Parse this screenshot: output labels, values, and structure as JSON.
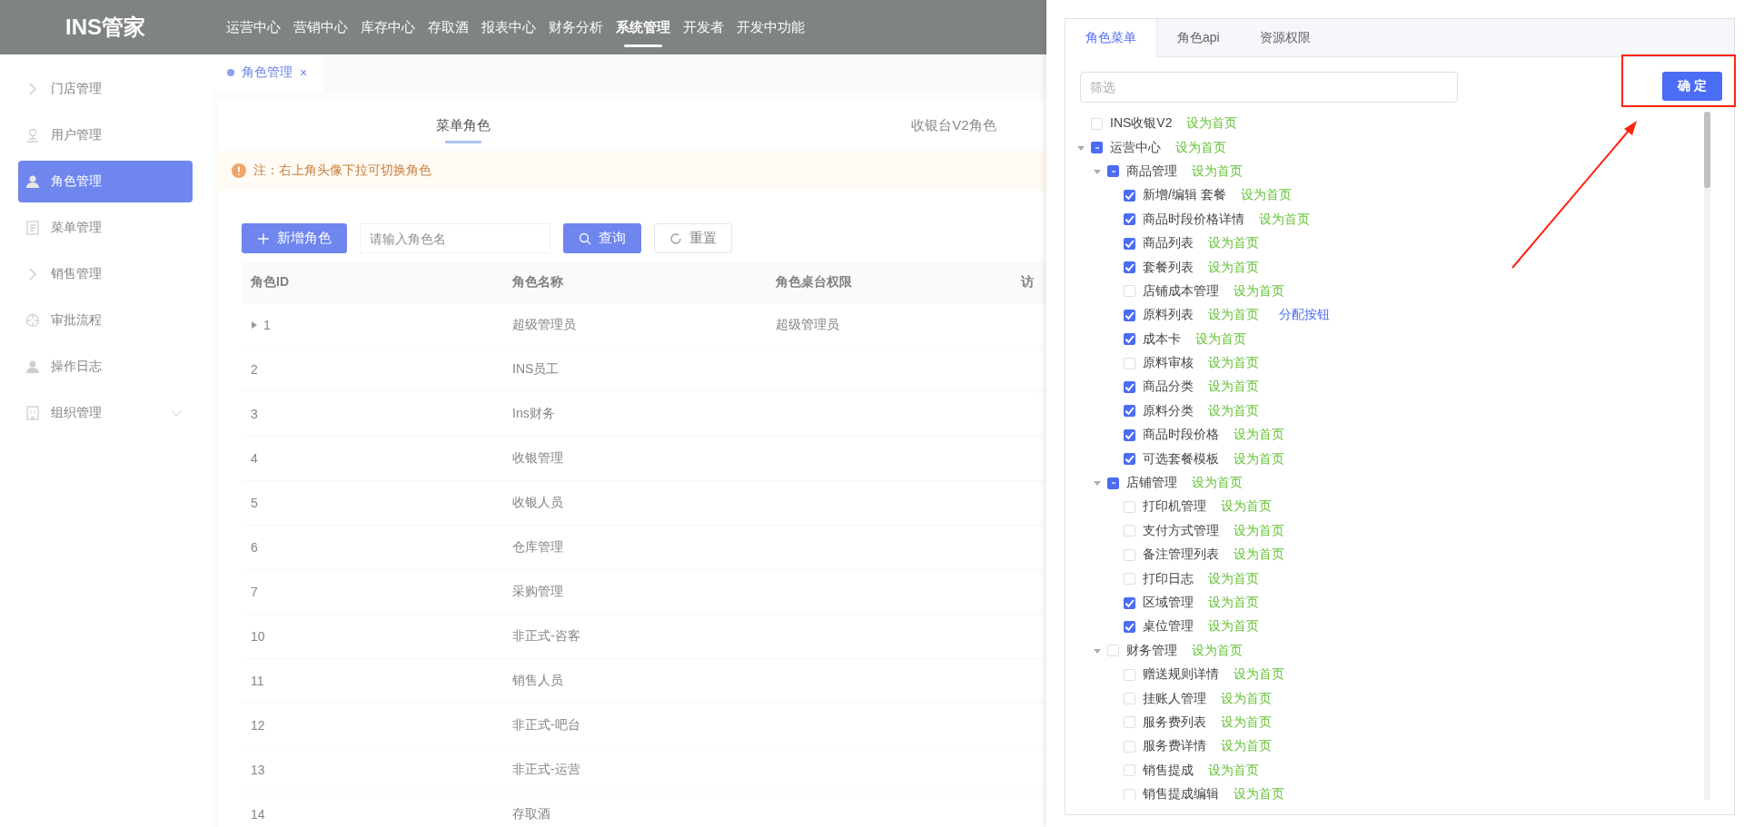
{
  "header": {
    "logo": "INS管家",
    "nav": [
      {
        "label": "运营中心",
        "selected": false
      },
      {
        "label": "营销中心",
        "selected": false
      },
      {
        "label": "库存中心",
        "selected": false
      },
      {
        "label": "存取酒",
        "selected": false
      },
      {
        "label": "报表中心",
        "selected": false
      },
      {
        "label": "财务分析",
        "selected": false
      },
      {
        "label": "系统管理",
        "selected": true
      },
      {
        "label": "开发者",
        "selected": false
      },
      {
        "label": "开发中功能",
        "selected": false
      }
    ]
  },
  "sidebar": {
    "items": [
      {
        "label": "门店管理",
        "selected": false,
        "submenu": false
      },
      {
        "label": "用户管理",
        "selected": false,
        "submenu": false
      },
      {
        "label": "角色管理",
        "selected": true,
        "submenu": false
      },
      {
        "label": "菜单管理",
        "selected": false,
        "submenu": false
      },
      {
        "label": "销售管理",
        "selected": false,
        "submenu": false
      },
      {
        "label": "审批流程",
        "selected": false,
        "submenu": false
      },
      {
        "label": "操作日志",
        "selected": false,
        "submenu": false
      },
      {
        "label": "组织管理",
        "selected": false,
        "submenu": true
      }
    ]
  },
  "page_tabs": [
    {
      "label": "角色管理",
      "selected": true,
      "close": "×"
    }
  ],
  "role_tabs": [
    {
      "label": "菜单角色",
      "selected": true
    },
    {
      "label": "收银台V2角色",
      "selected": false
    }
  ],
  "notice": "注：右上角头像下拉可切换角色",
  "toolbar": {
    "add_button": "新增角色",
    "search": {
      "placeholder": "请输入角色名"
    },
    "query_button": "查询",
    "reset_button": "重置"
  },
  "table": {
    "columns": [
      "角色ID",
      "角色名称",
      "角色桌台权限",
      "访"
    ],
    "rows": [
      {
        "id": "1",
        "name": "超级管理员",
        "desk": "超级管理员",
        "expandable": true
      },
      {
        "id": "2",
        "name": "INS员工",
        "desk": "",
        "expandable": false
      },
      {
        "id": "3",
        "name": "Ins财务",
        "desk": "",
        "expandable": false
      },
      {
        "id": "4",
        "name": "收银管理",
        "desk": "",
        "expandable": false
      },
      {
        "id": "5",
        "name": "收银人员",
        "desk": "",
        "expandable": false
      },
      {
        "id": "6",
        "name": "仓库管理",
        "desk": "",
        "expandable": false
      },
      {
        "id": "7",
        "name": "采购管理",
        "desk": "",
        "expandable": false
      },
      {
        "id": "10",
        "name": "非正式-咨客",
        "desk": "",
        "expandable": false
      },
      {
        "id": "11",
        "name": "销售人员",
        "desk": "",
        "expandable": false
      },
      {
        "id": "12",
        "name": "非正式-吧台",
        "desk": "",
        "expandable": false
      },
      {
        "id": "13",
        "name": "非正式-运营",
        "desk": "",
        "expandable": false
      },
      {
        "id": "14",
        "name": "存取酒",
        "desk": "",
        "expandable": false
      }
    ]
  },
  "drawer": {
    "tabs": [
      {
        "label": "角色菜单",
        "selected": true
      },
      {
        "label": "角色api",
        "selected": false
      },
      {
        "label": "资源权限",
        "selected": false
      }
    ],
    "filter": {
      "placeholder": "筛选"
    },
    "confirm_button": "确 定",
    "tree": [
      {
        "label": "INS收银V2",
        "checked": false,
        "indeterminate": false,
        "action": "设为首页"
      },
      {
        "label": "运营中心",
        "checked": false,
        "indeterminate": true,
        "expanded": true,
        "action": "设为首页",
        "children": [
          {
            "label": "商品管理",
            "checked": false,
            "indeterminate": true,
            "expanded": true,
            "action": "设为首页",
            "children": [
              {
                "label": "新增/编辑 套餐",
                "checked": true,
                "indeterminate": false,
                "action": "设为首页"
              },
              {
                "label": "商品时段价格详情",
                "checked": true,
                "indeterminate": false,
                "action": "设为首页"
              },
              {
                "label": "商品列表",
                "checked": true,
                "indeterminate": false,
                "action": "设为首页"
              },
              {
                "label": "套餐列表",
                "checked": true,
                "indeterminate": false,
                "action": "设为首页"
              },
              {
                "label": "店铺成本管理",
                "checked": false,
                "indeterminate": false,
                "action": "设为首页"
              },
              {
                "label": "原料列表",
                "checked": true,
                "indeterminate": false,
                "action": "设为首页",
                "extra_action": "分配按钮"
              },
              {
                "label": "成本卡",
                "checked": true,
                "indeterminate": false,
                "action": "设为首页"
              },
              {
                "label": "原料审核",
                "checked": false,
                "indeterminate": false,
                "action": "设为首页"
              },
              {
                "label": "商品分类",
                "checked": true,
                "indeterminate": false,
                "action": "设为首页"
              },
              {
                "label": "原料分类",
                "checked": true,
                "indeterminate": false,
                "action": "设为首页"
              },
              {
                "label": "商品时段价格",
                "checked": true,
                "indeterminate": false,
                "action": "设为首页"
              },
              {
                "label": "可选套餐模板",
                "checked": true,
                "indeterminate": false,
                "action": "设为首页"
              }
            ]
          },
          {
            "label": "店铺管理",
            "checked": false,
            "indeterminate": true,
            "expanded": true,
            "action": "设为首页",
            "children": [
              {
                "label": "打印机管理",
                "checked": false,
                "indeterminate": false,
                "action": "设为首页"
              },
              {
                "label": "支付方式管理",
                "checked": false,
                "indeterminate": false,
                "action": "设为首页"
              },
              {
                "label": "备注管理列表",
                "checked": false,
                "indeterminate": false,
                "action": "设为首页"
              },
              {
                "label": "打印日志",
                "checked": false,
                "indeterminate": false,
                "action": "设为首页"
              },
              {
                "label": "区域管理",
                "checked": true,
                "indeterminate": false,
                "action": "设为首页"
              },
              {
                "label": "桌位管理",
                "checked": true,
                "indeterminate": false,
                "action": "设为首页"
              }
            ]
          },
          {
            "label": "财务管理",
            "checked": false,
            "indeterminate": false,
            "expanded": true,
            "action": "设为首页",
            "children": [
              {
                "label": "赠送规则详情",
                "checked": false,
                "indeterminate": false,
                "action": "设为首页"
              },
              {
                "label": "挂账人管理",
                "checked": false,
                "indeterminate": false,
                "action": "设为首页"
              },
              {
                "label": "服务费列表",
                "checked": false,
                "indeterminate": false,
                "action": "设为首页"
              },
              {
                "label": "服务费详情",
                "checked": false,
                "indeterminate": false,
                "action": "设为首页"
              },
              {
                "label": "销售提成",
                "checked": false,
                "indeterminate": false,
                "action": "设为首页"
              },
              {
                "label": "销售提成编辑",
                "checked": false,
                "indeterminate": false,
                "action": "设为首页"
              }
            ]
          }
        ]
      }
    ]
  }
}
